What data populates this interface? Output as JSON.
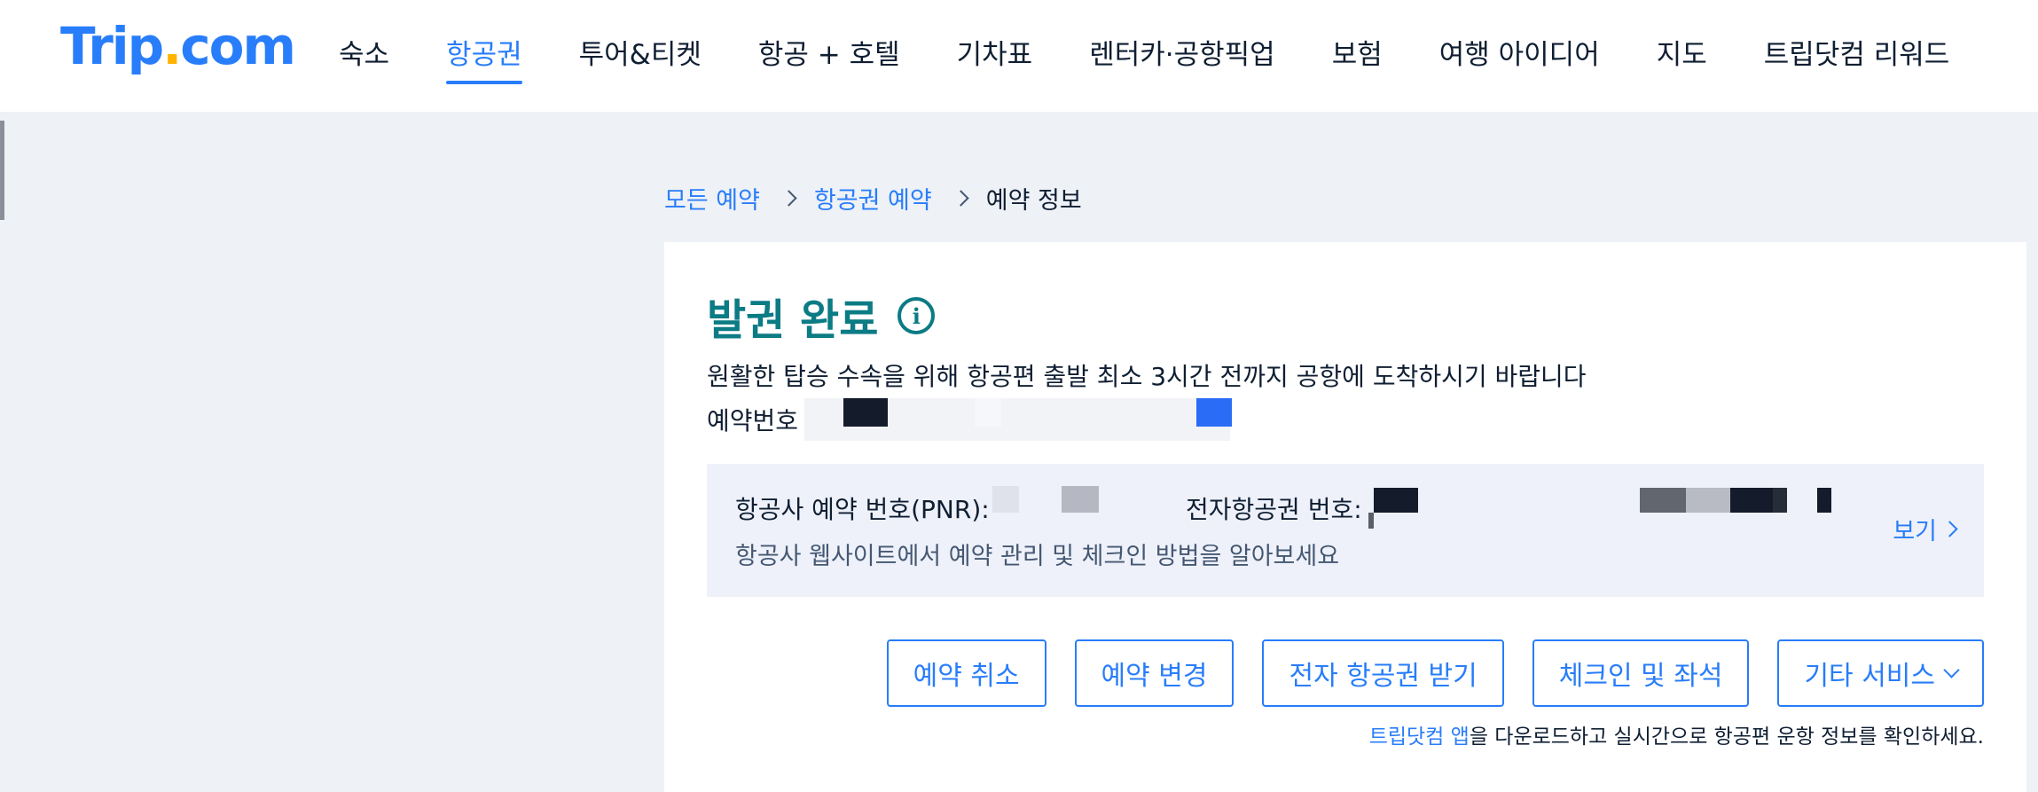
{
  "header": {
    "logo_main": "Trip",
    "logo_dot": ".",
    "logo_tail": "com",
    "nav": [
      {
        "label": "숙소"
      },
      {
        "label": "항공권"
      },
      {
        "label": "투어&티켓"
      },
      {
        "label": "항공 + 호텔"
      },
      {
        "label": "기차표"
      },
      {
        "label": "렌터카·공항픽업"
      },
      {
        "label": "보험"
      },
      {
        "label": "여행 아이디어"
      },
      {
        "label": "지도"
      },
      {
        "label": "트립닷컴 리워드"
      }
    ],
    "active_nav": "항공권"
  },
  "breadcrumb": {
    "items": [
      "모든 예약",
      "항공권 예약"
    ],
    "current": "예약 정보"
  },
  "status": {
    "title": "발권 완료",
    "notice": "원활한 탑승 수속을 위해 항공편 출발 최소 3시간 전까지 공항에 도착하시기 바랍니다",
    "booking_label": "예약번호"
  },
  "pnr_panel": {
    "pnr_label": "항공사 예약 번호(PNR):",
    "eticket_label": "전자항공권 번호:",
    "sub_text": "항공사 웹사이트에서 예약 관리 및 체크인 방법을 알아보세요",
    "view_link": "보기"
  },
  "actions": {
    "cancel": "예약 취소",
    "change": "예약 변경",
    "eticket": "전자 항공권 받기",
    "checkin": "체크인 및 좌석",
    "other": "기타 서비스"
  },
  "app_note": {
    "link": "트립닷컴 앱",
    "text": "을 다운로드하고 실시간으로 항공편 운항 정보를 확인하세요."
  },
  "colors": {
    "brand_blue": "#287dfa",
    "brand_yellow": "#ffb400",
    "status_teal": "#0b7b84",
    "page_bg": "#eef1f6"
  }
}
